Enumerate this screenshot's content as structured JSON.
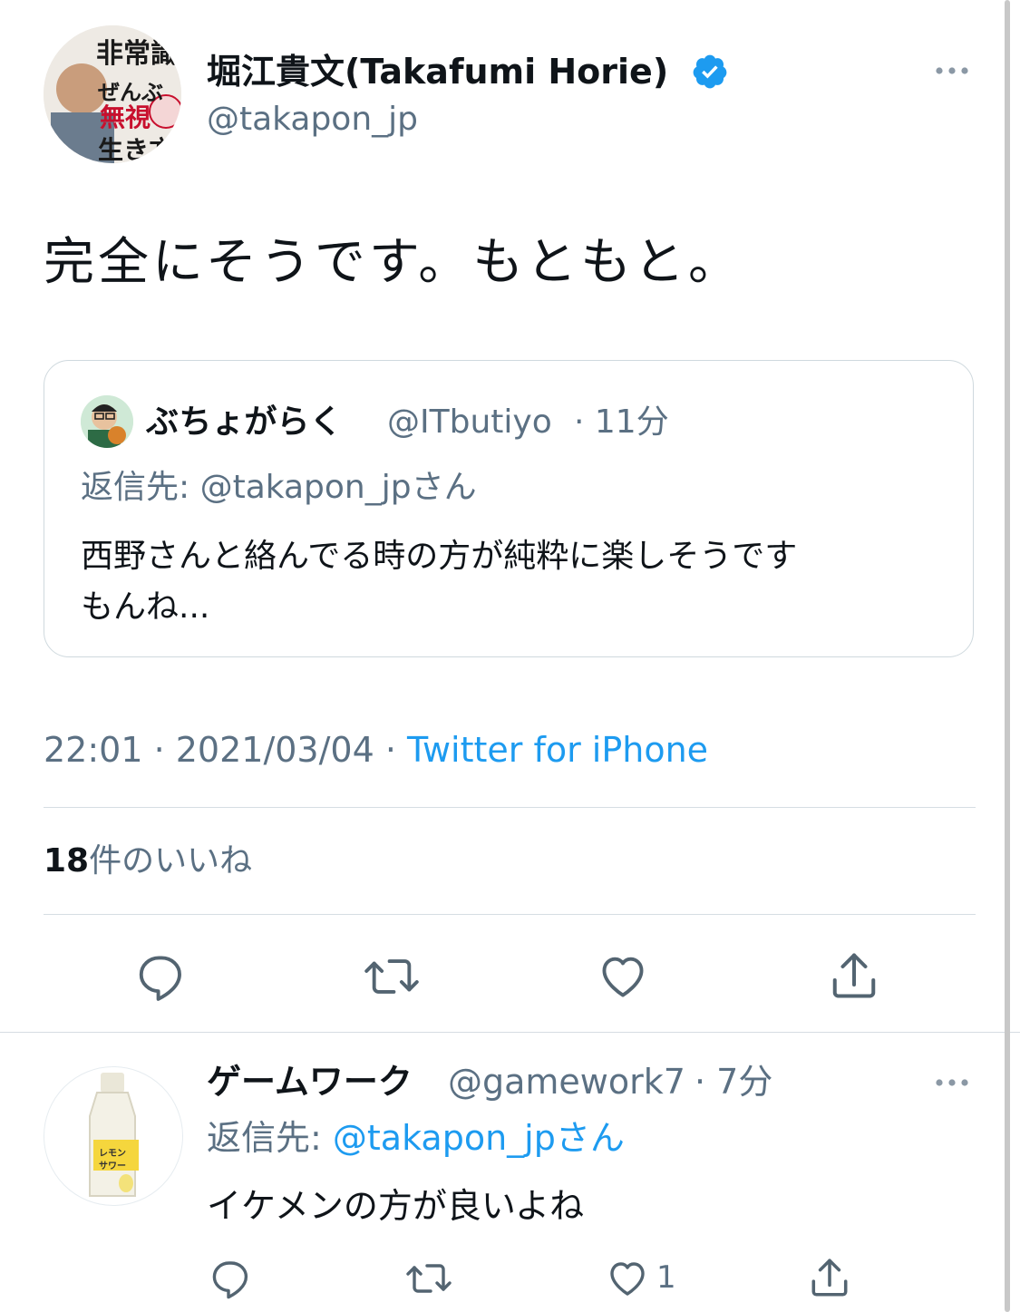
{
  "main_tweet": {
    "author_name": "堀江貴文(Takafumi Horie)",
    "author_handle": "@takapon_jp",
    "avatar_text": [
      "非常識",
      "ぜんぶ",
      "無視",
      "生き方"
    ],
    "text": "完全にそうです。もともと。",
    "timestamp": "22:01 · 2021/03/04 · ",
    "client": "Twitter for iPhone",
    "likes_count": "18",
    "likes_label": "件のいいね"
  },
  "quoted_tweet": {
    "author_name": "ぶちょがらく",
    "author_handle": "@ITbutiyo",
    "time_ago": " · 11分",
    "reply_to_prefix": "返信先: ",
    "reply_to_handle": "@takapon_jpさん",
    "text_line1": "西野さんと絡んでる時の方が純粋に楽しそうです",
    "text_line2": "もんね..."
  },
  "reply_tweet": {
    "author_name": "ゲームワーク",
    "author_handle": "@gamework7",
    "time_ago": " · 7分",
    "reply_to_prefix": "返信先: ",
    "reply_to_handle": "@takapon_jpさん",
    "text": "イケメンの方が良いよね",
    "like_count": "1",
    "avatar_text": [
      "レモン",
      "サワー"
    ]
  },
  "colors": {
    "accent": "#1d9bf0",
    "secondary_text": "#5b7083",
    "icon": "#536471",
    "verified": "#1d9bf0"
  },
  "icons": [
    "verified-badge-icon",
    "more-icon",
    "reply-icon",
    "retweet-icon",
    "like-icon",
    "share-icon"
  ]
}
